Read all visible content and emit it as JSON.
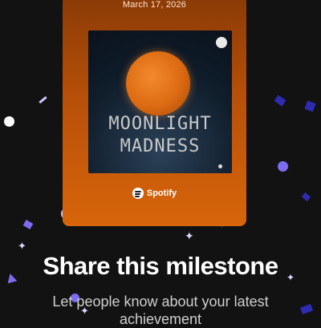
{
  "card": {
    "date": "March 17, 2026",
    "background_color": "#c4560a"
  },
  "album": {
    "title_line1": "MOONLIGHT",
    "title_line2": "MADNESS"
  },
  "brand": {
    "name": "Spotify",
    "icon": "spotify-icon"
  },
  "heading": "Share this milestone",
  "subheading_line1": "Let people know about your latest",
  "subheading_line2": "achievement",
  "colors": {
    "background": "#121212",
    "accent_purple": "#7b6cf0",
    "accent_navy": "#2f2bb0"
  }
}
